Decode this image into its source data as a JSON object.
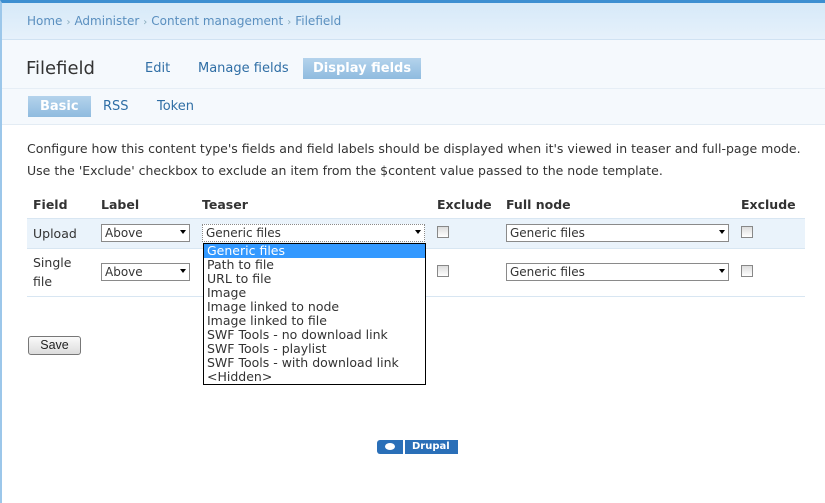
{
  "breadcrumb": [
    "Home",
    "Administer",
    "Content management",
    "Filefield"
  ],
  "page_title": "Filefield",
  "primary_tabs": [
    "Edit",
    "Manage fields",
    "Display fields"
  ],
  "secondary_tabs": [
    "Basic",
    "RSS",
    "Token"
  ],
  "description": "Configure how this content type's fields and field labels should be displayed when it's viewed in teaser and full-page mode. Use the 'Exclude' checkbox to exclude an item from the $content value passed to the node template.",
  "table": {
    "headers": [
      "Field",
      "Label",
      "Teaser",
      "Exclude",
      "Full node",
      "Exclude"
    ],
    "rows": [
      {
        "field": "Upload",
        "label": "Above",
        "teaser": "Generic files",
        "teaser_exclude": false,
        "full": "Generic files",
        "full_exclude": false
      },
      {
        "field": "Single file",
        "label": "Above",
        "teaser": "",
        "teaser_exclude": false,
        "full": "Generic files",
        "full_exclude": false
      }
    ]
  },
  "dropdown_options": [
    "Generic files",
    "Path to file",
    "URL to file",
    "Image",
    "Image linked to node",
    "Image linked to file",
    "SWF Tools - no download link",
    "SWF Tools - playlist",
    "SWF Tools - with download link",
    "<Hidden>"
  ],
  "save_label": "Save",
  "footer_logo": "Drupal"
}
